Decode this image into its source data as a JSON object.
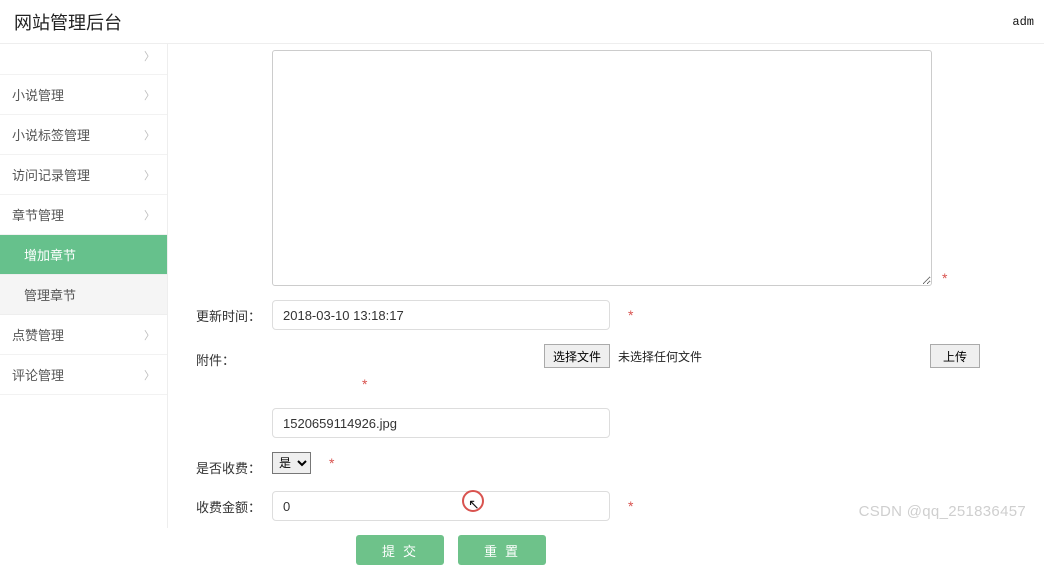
{
  "header": {
    "title": "网站管理后台",
    "user": "adm"
  },
  "sidebar": {
    "items": [
      {
        "label": "",
        "partial": true
      },
      {
        "label": "小说管理"
      },
      {
        "label": "小说标签管理"
      },
      {
        "label": "访问记录管理"
      },
      {
        "label": "章节管理",
        "expanded": true,
        "children": [
          {
            "label": "增加章节",
            "active": true
          },
          {
            "label": "管理章节"
          }
        ]
      },
      {
        "label": "点赞管理"
      },
      {
        "label": "评论管理"
      }
    ]
  },
  "form": {
    "content_label": "",
    "content_value": "",
    "update_time_label": "更新时间：",
    "update_time_value": "2018-03-10 13:18:17",
    "attach_label": "附件：",
    "attach_value": "1520659114926.jpg",
    "choose_file_label": "选择文件",
    "choose_file_state": "未选择任何文件",
    "upload_label": "上传",
    "is_charge_label": "是否收费：",
    "is_charge_value": "是",
    "charge_amount_label": "收费金额：",
    "charge_amount_value": "0",
    "submit_label": "提交",
    "reset_label": "重置",
    "required_mark": "*"
  },
  "watermark": "CSDN @qq_251836457"
}
